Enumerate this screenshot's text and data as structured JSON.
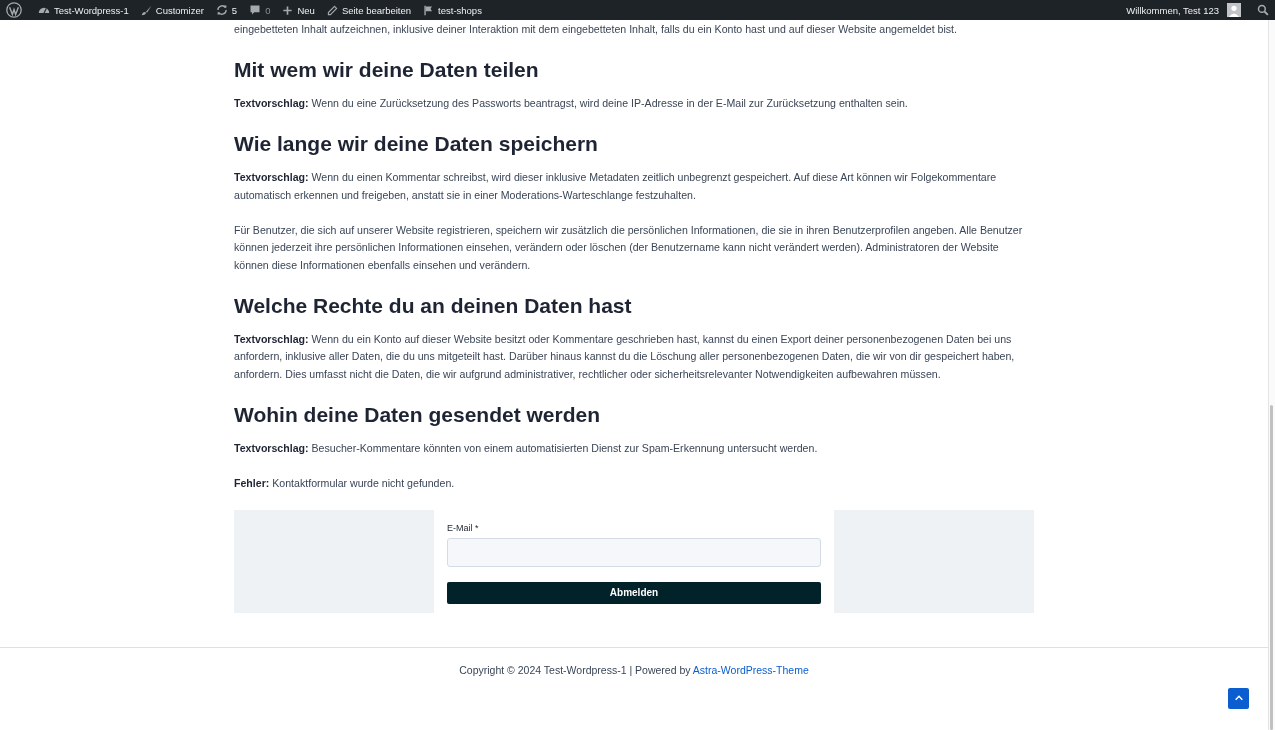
{
  "admin_bar": {
    "items": [
      {
        "kind": "wp-logo"
      },
      {
        "kind": "site",
        "label": "Test-Wordpress-1",
        "disabled": false
      },
      {
        "kind": "customizer",
        "label": "Customizer",
        "disabled": false
      },
      {
        "kind": "updates",
        "label": "5",
        "disabled": false
      },
      {
        "kind": "comments",
        "label": "0",
        "disabled": true
      },
      {
        "kind": "new",
        "label": "Neu",
        "disabled": false
      },
      {
        "kind": "edit",
        "label": "Seite bearbeiten",
        "disabled": false
      },
      {
        "kind": "flag",
        "label": "test-shops",
        "disabled": false
      }
    ],
    "greeting": "Willkommen, Test 123"
  },
  "content": [
    {
      "kind": "paragraph",
      "text": "eingebetteten Inhalt aufzeichnen, inklusive deiner Interaktion mit dem eingebetteten Inhalt, falls du ein Konto hast und auf dieser Website angemeldet bist."
    },
    {
      "kind": "heading",
      "text": "Mit wem wir deine Daten teilen"
    },
    {
      "kind": "paragraph",
      "text": "**Textvorschlag:** Wenn du eine Zurücksetzung des Passworts beantragst, wird deine IP-Adresse in der E-Mail zur Zurücksetzung enthalten sein."
    },
    {
      "kind": "heading",
      "text": "Wie lange wir deine Daten speichern"
    },
    {
      "kind": "paragraph",
      "text": "**Textvorschlag:** Wenn du einen Kommentar schreibst, wird dieser inklusive Metadaten zeitlich unbegrenzt gespeichert. Auf diese Art können wir Folgekommentare automatisch erkennen und freigeben, anstatt sie in einer Moderations-Warteschlange festzuhalten."
    },
    {
      "kind": "paragraph",
      "text": "Für Benutzer, die sich auf unserer Website registrieren, speichern wir zusätzlich die persönlichen Informationen, die sie in ihren Benutzerprofilen angeben. Alle Benutzer können jederzeit ihre persönlichen Informationen einsehen, verändern oder löschen (der Benutzername kann nicht verändert werden). Administratoren der Website können diese Informationen ebenfalls einsehen und verändern."
    },
    {
      "kind": "heading",
      "text": "Welche Rechte du an deinen Daten hast"
    },
    {
      "kind": "paragraph",
      "text": "**Textvorschlag:** Wenn du ein Konto auf dieser Website besitzt oder Kommentare geschrieben hast, kannst du einen Export deiner personenbezogenen Daten bei uns anfordern, inklusive aller Daten, die du uns mitgeteilt hast. Darüber hinaus kannst du die Löschung aller personenbezogenen Daten, die wir von dir gespeichert haben, anfordern. Dies umfasst nicht die Daten, die wir aufgrund administrativer, rechtlicher oder sicherheitsrelevanter Notwendigkeiten aufbewahren müssen."
    },
    {
      "kind": "heading",
      "text": "Wohin deine Daten gesendet werden"
    },
    {
      "kind": "paragraph",
      "text": "**Textvorschlag:** Besucher-Kommentare könnten von einem automatisierten Dienst zur Spam-Erkennung untersucht werden."
    },
    {
      "kind": "paragraph",
      "text": "**Fehler:** Kontaktformular wurde nicht gefunden."
    }
  ],
  "form": {
    "label": "E-Mail *",
    "button": "Abmelden"
  },
  "footer": {
    "text": "Copyright © 2024 Test-Wordpress-1 | Powered by ",
    "link": "Astra-WordPress-Theme"
  }
}
